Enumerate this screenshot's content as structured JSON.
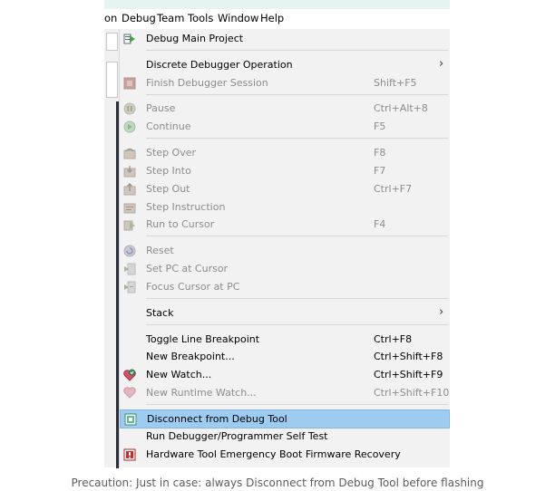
{
  "menubar": {
    "items": [
      "on",
      "Debug",
      "Team",
      "Tools",
      "Window",
      "Help"
    ]
  },
  "menu": {
    "items": [
      {
        "label": "Debug Main Project",
        "shortcut": "",
        "enabled": true,
        "icon": "debug-project-icon"
      },
      {
        "label": "Discrete Debugger Operation",
        "shortcut": "",
        "enabled": true,
        "submenu": true
      },
      {
        "label": "Finish Debugger Session",
        "shortcut": "Shift+F5",
        "enabled": false,
        "icon": "stop-icon"
      },
      {
        "label": "Pause",
        "shortcut": "Ctrl+Alt+8",
        "enabled": false,
        "icon": "pause-icon"
      },
      {
        "label": "Continue",
        "shortcut": "F5",
        "enabled": false,
        "icon": "continue-icon"
      },
      {
        "label": "Step Over",
        "shortcut": "F8",
        "enabled": false,
        "icon": "step-over-icon"
      },
      {
        "label": "Step Into",
        "shortcut": "F7",
        "enabled": false,
        "icon": "step-into-icon"
      },
      {
        "label": "Step Out",
        "shortcut": "Ctrl+F7",
        "enabled": false,
        "icon": "step-out-icon"
      },
      {
        "label": "Step Instruction",
        "shortcut": "",
        "enabled": false,
        "icon": "step-instruction-icon"
      },
      {
        "label": "Run to Cursor",
        "shortcut": "F4",
        "enabled": false,
        "icon": "run-to-cursor-icon"
      },
      {
        "label": "Reset",
        "shortcut": "",
        "enabled": false,
        "icon": "reset-icon"
      },
      {
        "label": "Set PC at Cursor",
        "shortcut": "",
        "enabled": false,
        "icon": "set-pc-icon"
      },
      {
        "label": "Focus Cursor at PC",
        "shortcut": "",
        "enabled": false,
        "icon": "focus-cursor-icon"
      },
      {
        "label": "Stack",
        "shortcut": "",
        "enabled": true,
        "submenu": true
      },
      {
        "label": "Toggle Line Breakpoint",
        "shortcut": "Ctrl+F8",
        "enabled": true
      },
      {
        "label": "New Breakpoint...",
        "shortcut": "Ctrl+Shift+F8",
        "enabled": true
      },
      {
        "label": "New Watch...",
        "shortcut": "Ctrl+Shift+F9",
        "enabled": true,
        "icon": "watch-icon"
      },
      {
        "label": "New Runtime Watch...",
        "shortcut": "Ctrl+Shift+F10",
        "enabled": false,
        "icon": "runtime-watch-icon"
      },
      {
        "label": "Disconnect from Debug Tool",
        "shortcut": "",
        "enabled": true,
        "highlighted": true,
        "icon": "disconnect-icon"
      },
      {
        "label": "Run Debugger/Programmer Self Test",
        "shortcut": "",
        "enabled": true
      },
      {
        "label": "Hardware Tool Emergency Boot Firmware Recovery",
        "shortcut": "",
        "enabled": true,
        "icon": "emergency-boot-icon"
      }
    ]
  },
  "colors": {
    "highlight": "#9ecbf0",
    "menu_bg": "#f2f2f2",
    "disabled_text": "#8c8c8c"
  },
  "caption": "Precaution: Just in case: always Disconnect from Debug Tool before flashing"
}
